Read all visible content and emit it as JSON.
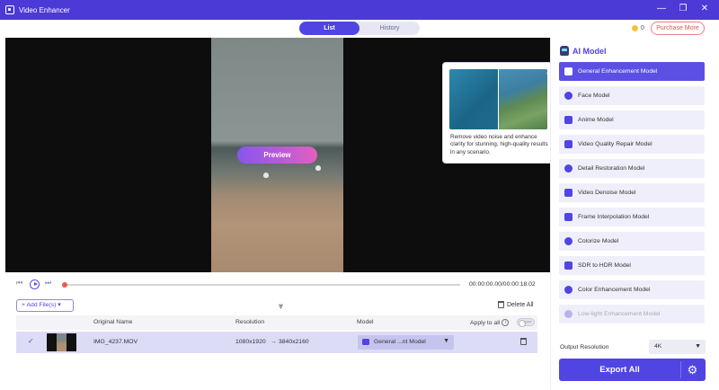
{
  "window": {
    "title": "Video Enhancer",
    "controls": [
      "—",
      "❐",
      "✕"
    ]
  },
  "tabs": [
    {
      "label": "List",
      "active": true
    },
    {
      "label": "History",
      "active": false
    }
  ],
  "header": {
    "coins": "0",
    "purchase_label": "Purchase More"
  },
  "preview": {
    "button_label": "Preview"
  },
  "tooltip": {
    "text": "Remove video noise and enhance clarity for stunning, high-quality results in any scenario."
  },
  "playback": {
    "timecode": "00:00:00.00/00:00:18.02",
    "progress_fraction": 0.0
  },
  "toolbar": {
    "add_files_label": "Add File(s)",
    "delete_all_label": "Delete All"
  },
  "table": {
    "headers": {
      "original_name": "Original Name",
      "resolution": "Resolution",
      "model": "Model",
      "apply_to_all": "Apply to all",
      "toggle": "OFF"
    },
    "rows": [
      {
        "name": "IMG_4237.MOV",
        "res_from": "1080x1920",
        "arrow": "→",
        "res_to": "3840x2160",
        "model": "General ...nt Model"
      }
    ]
  },
  "panel": {
    "title": "AI Model",
    "models": [
      {
        "label": "General Enhancement Model",
        "state": "active"
      },
      {
        "label": "Face Model",
        "state": "normal"
      },
      {
        "label": "Anime Model",
        "state": "normal"
      },
      {
        "label": "Video Quality Repair Model",
        "state": "normal"
      },
      {
        "label": "Detail Restoration Model",
        "state": "normal"
      },
      {
        "label": "Video Denoise Model",
        "state": "normal"
      },
      {
        "label": "Frame Interpolation Model",
        "state": "normal"
      },
      {
        "label": "Colorize Model",
        "state": "normal"
      },
      {
        "label": "SDR to HDR Model",
        "state": "normal"
      },
      {
        "label": "Color Enhancement Model",
        "state": "normal"
      },
      {
        "label": "Low-light Enhancement Model",
        "state": "disabled"
      }
    ],
    "output_resolution_label": "Output Resolution",
    "output_resolution_value": "4K",
    "export_label": "Export All"
  },
  "colors": {
    "accent": "#5044e2",
    "titlebar": "#4b3ad6",
    "purchase": "#e0544f",
    "progress_knob": "#f05a43"
  }
}
